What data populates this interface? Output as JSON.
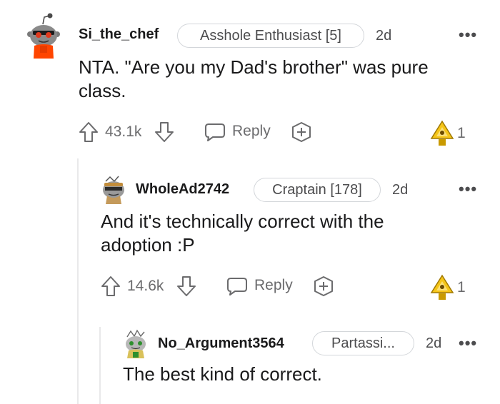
{
  "comments": [
    {
      "username": "Si_the_chef",
      "flair": "Asshole Enthusiast [5]",
      "age": "2d",
      "body": "NTA. \"Are you my Dad's brother\" was pure class.",
      "score": "43.1k",
      "reply_label": "Reply",
      "award_count": "1",
      "more_label": "•••"
    },
    {
      "username": "WholeAd2742",
      "flair": "Craptain [178]",
      "age": "2d",
      "body": "And it's technically correct with the adoption :P",
      "score": "14.6k",
      "reply_label": "Reply",
      "award_count": "1",
      "more_label": "•••"
    },
    {
      "username": "No_Argument3564",
      "flair": "Partassi...",
      "age": "2d",
      "body": "The best kind of correct.",
      "more_label": "•••"
    }
  ],
  "colors": {
    "accent_orange": "#ff4500",
    "award_gold": "#f5c518",
    "text_primary": "#1a1a1b",
    "text_secondary": "#6b6b6d",
    "thread_line": "#e9e9ea"
  },
  "icons": [
    "upvote-icon",
    "downvote-icon",
    "reply-icon",
    "add-award-icon",
    "award-icon",
    "more-icon"
  ]
}
